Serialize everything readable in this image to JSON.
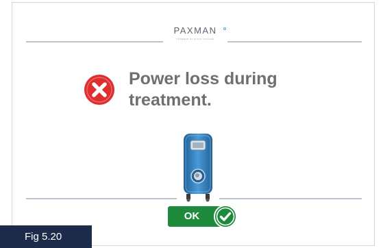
{
  "header": {
    "brand": "PAXMAN",
    "tagline": "POWERED BY SCALP COOLING"
  },
  "dialog": {
    "message_line1": "Power loss during",
    "message_line2": "treatment.",
    "ok_label": "OK"
  },
  "figure": {
    "caption": "Fig 5.20"
  },
  "icons": {
    "error": "error-x-circle-icon",
    "device": "scalp-cooling-machine-icon",
    "confirm": "checkmark-circle-icon"
  },
  "colors": {
    "error_red": "#e02d2d",
    "ok_green": "#1e8a3c",
    "device_blue": "#3c86c5",
    "message_gray": "#6f6f6f",
    "caption_bg": "#1c2b4a"
  }
}
